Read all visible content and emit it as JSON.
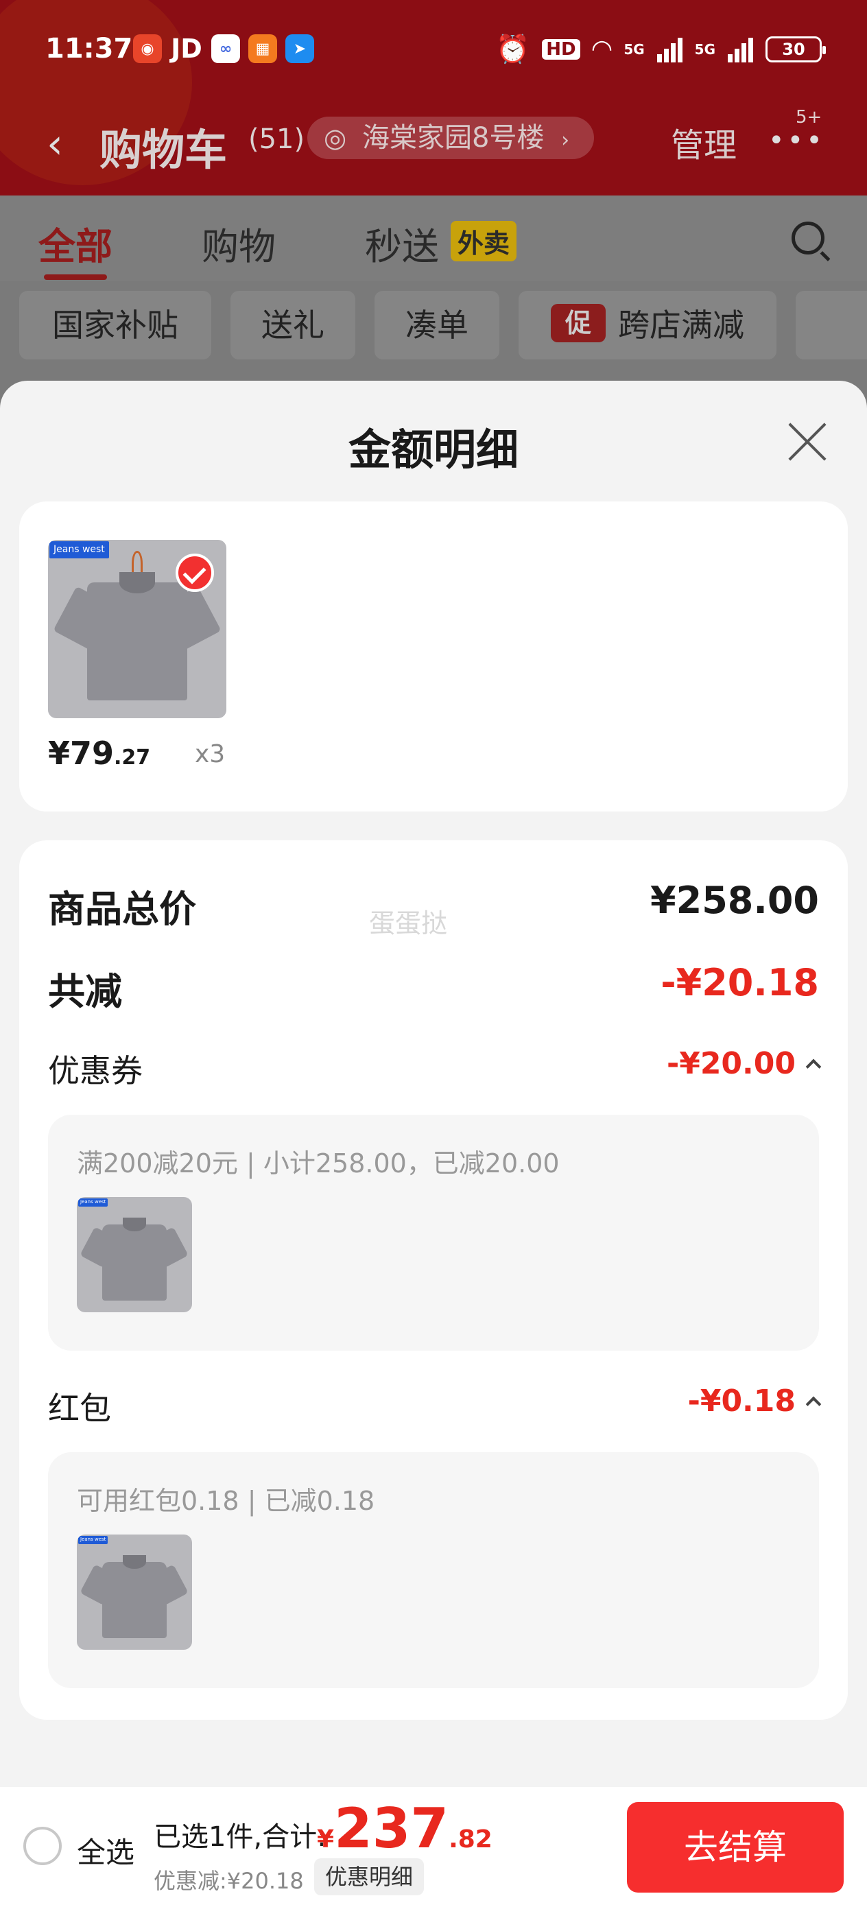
{
  "status_bar": {
    "time": "11:37",
    "jd": "JD",
    "hd": "HD",
    "net1": "5G",
    "net2": "5G",
    "battery": "30"
  },
  "header": {
    "title": "购物车",
    "count": "(51)",
    "address": "海棠家园8号楼",
    "manage": "管理",
    "more_badge": "5+"
  },
  "tabs": [
    {
      "label": "全部"
    },
    {
      "label": "购物"
    },
    {
      "label": "秒送"
    }
  ],
  "tab_badge": "外卖",
  "chips": [
    {
      "label": "国家补贴"
    },
    {
      "label": "送礼"
    },
    {
      "label": "凑单"
    },
    {
      "label": "跨店满减"
    }
  ],
  "promo_tag": "促",
  "sheet": {
    "title": "金额明细",
    "product": {
      "price_int": "¥79",
      "price_dec": ".27",
      "qty": "x3",
      "brand_logo": "Jeans west"
    },
    "watermark": "蛋蛋挞",
    "total_label": "商品总价",
    "total_value": "¥258.00",
    "discount_label": "共减",
    "discount_value": "-¥20.18",
    "coupon": {
      "label": "优惠券",
      "value": "-¥20.00",
      "desc": "满200减20元 | 小计258.00，已减20.00"
    },
    "redpacket": {
      "label": "红包",
      "value": "-¥0.18",
      "desc": "可用红包0.18 | 已减0.18"
    }
  },
  "bottom": {
    "select_all": "全选",
    "summary": "已选1件,合计:",
    "currency": "¥",
    "total_int": "237",
    "total_dec": ".82",
    "discount_line": "优惠减:¥20.18",
    "detail_button": "优惠明细",
    "checkout": "去结算"
  },
  "colors": {
    "accent_red": "#e8281e",
    "checkout_red": "#f62e2e",
    "header_red": "#8b0d14"
  }
}
